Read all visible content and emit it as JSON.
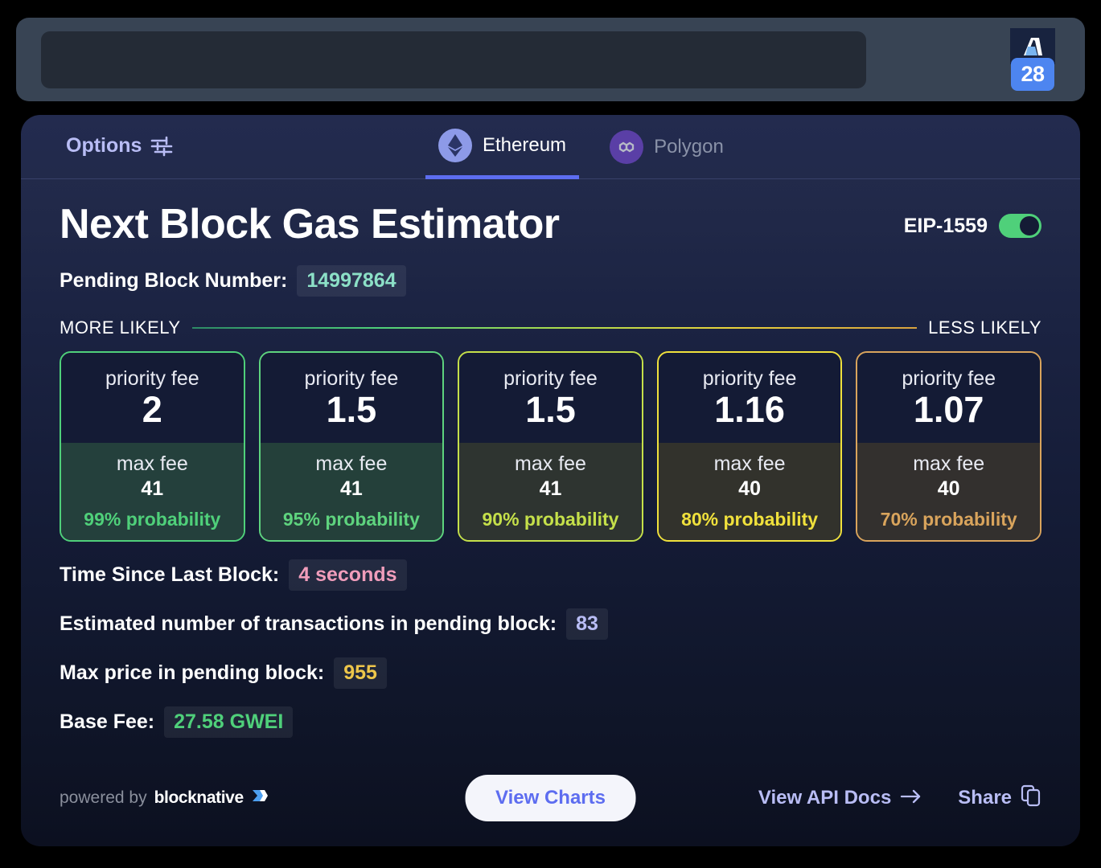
{
  "browser": {
    "address_bar_value": "",
    "address_bar_placeholder": "",
    "extension": {
      "icon": "blocknative-logo-icon",
      "badge_count": "28"
    }
  },
  "panel": {
    "options_label": "Options",
    "options_icon": "sliders-icon",
    "tabs": [
      {
        "label": "Ethereum",
        "icon": "ethereum-icon",
        "active": true
      },
      {
        "label": "Polygon",
        "icon": "polygon-icon",
        "active": false
      }
    ],
    "title": "Next Block Gas Estimator",
    "eip": {
      "label": "EIP-1559",
      "toggle_state": "on"
    },
    "pending_block": {
      "label": "Pending Block Number:",
      "value": "14997864"
    },
    "scale": {
      "left_label": "MORE LIKELY",
      "right_label": "LESS LIKELY"
    },
    "cards": [
      {
        "priority_fee_label": "priority fee",
        "priority_fee": "2",
        "max_fee_label": "max fee",
        "max_fee": "41",
        "probability": "99% probability",
        "color": "#4fd07a",
        "fill": "#24403c"
      },
      {
        "priority_fee_label": "priority fee",
        "priority_fee": "1.5",
        "max_fee_label": "max fee",
        "max_fee": "41",
        "probability": "95% probability",
        "color": "#5ed37e",
        "fill": "#24403a"
      },
      {
        "priority_fee_label": "priority fee",
        "priority_fee": "1.5",
        "max_fee_label": "max fee",
        "max_fee": "41",
        "probability": "90% probability",
        "color": "#c5e04a",
        "fill": "#2e3430"
      },
      {
        "priority_fee_label": "priority fee",
        "priority_fee": "1.16",
        "max_fee_label": "max fee",
        "max_fee": "40",
        "probability": "80% probability",
        "color": "#f0e13c",
        "fill": "#32322c"
      },
      {
        "priority_fee_label": "priority fee",
        "priority_fee": "1.07",
        "max_fee_label": "max fee",
        "max_fee": "40",
        "probability": "70% probability",
        "color": "#d9a45c",
        "fill": "#33302e"
      }
    ],
    "stats": [
      {
        "label": "Time Since Last Block:",
        "value": "4 seconds",
        "chip_class": "chip-time"
      },
      {
        "label": "Estimated number of transactions in pending block:",
        "value": "83",
        "chip_class": "chip-txn"
      },
      {
        "label": "Max price in pending block:",
        "value": "955",
        "chip_class": "chip-price"
      },
      {
        "label": "Base Fee:",
        "value": "27.58 GWEI",
        "chip_class": "chip-base"
      }
    ],
    "footer": {
      "powered_by": "powered by",
      "brand": "blocknative",
      "view_charts": "View Charts",
      "api_docs": "View API Docs",
      "api_docs_icon": "arrow-right-icon",
      "share": "Share",
      "share_icon": "copy-icon"
    }
  }
}
